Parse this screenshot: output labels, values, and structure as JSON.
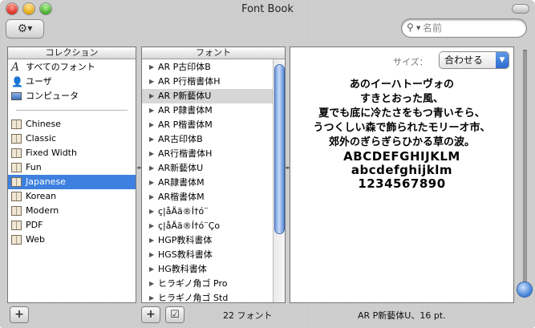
{
  "window": {
    "title": "Font Book"
  },
  "toolbar": {
    "gear_icon": "gear-icon",
    "search_placeholder": "名前"
  },
  "collections": {
    "header": "コレクション",
    "library_items": [
      {
        "label": "すべてのフォント",
        "icon": "all-fonts-icon"
      },
      {
        "label": "ユーザ",
        "icon": "user-icon"
      },
      {
        "label": "コンピュータ",
        "icon": "computer-icon"
      }
    ],
    "items": [
      {
        "label": "Chinese"
      },
      {
        "label": "Classic"
      },
      {
        "label": "Fixed Width"
      },
      {
        "label": "Fun"
      },
      {
        "label": "Japanese",
        "selected": true
      },
      {
        "label": "Korean"
      },
      {
        "label": "Modern"
      },
      {
        "label": "PDF"
      },
      {
        "label": "Web"
      }
    ]
  },
  "fonts": {
    "header": "フォント",
    "items": [
      "AR P古印体B",
      "AR P行楷書体H",
      "AR P新藝体U",
      "AR P隷書体M",
      "AR P楷書体M",
      "AR古印体B",
      "AR行楷書体H",
      "AR新藝体U",
      "AR隷書体M",
      "AR楷書体M",
      "ç|åÄä®Í†ó¨",
      "ç|åÄä®Í†ó¨Ço",
      "HGP教科書体",
      "HGS教科書体",
      "HG教科書体",
      "ヒラギノ角ゴ Pro",
      "ヒラギノ角ゴ Std"
    ],
    "highlighted_index": 2
  },
  "preview": {
    "size_label": "サイズ：",
    "size_value": "合わせる",
    "lines": [
      "あのイーハトーヴォの",
      "すきとおった風、",
      "夏でも底に冷たさをもつ青いそら、",
      "うつくしい森で飾られたモリーオ市、",
      "郊外のぎらぎらひかる草の波。",
      "ABCDEFGHIJKLM",
      "abcdefghijklm",
      "1234567890"
    ]
  },
  "status": {
    "font_count": "22 フォント",
    "selected_font": "AR P新藝体U、16 pt."
  },
  "bottom_buttons": {
    "add_collection": "+",
    "add_font": "+",
    "enable_check": "☑"
  }
}
